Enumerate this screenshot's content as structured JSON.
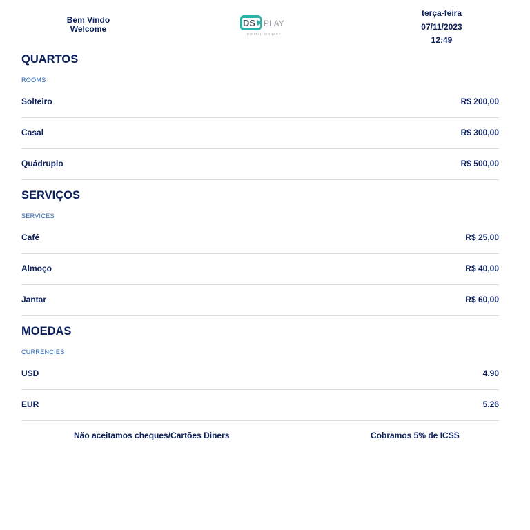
{
  "header": {
    "welcome_pt": "Bem Vindo",
    "welcome_en": "Welcome",
    "logo": {
      "brand_ds": "DS",
      "brand_play": "PLAY",
      "tagline": "DIGITAL SIGNAGE",
      "accent": "#2ab3a8",
      "text_color": "#9aa0a6"
    },
    "weekday": "terça-feira",
    "date": "07/11/2023",
    "time": "12:49"
  },
  "sections": [
    {
      "title": "QUARTOS",
      "subtitle": "ROOMS",
      "items": [
        {
          "name": "Solteiro",
          "price": "R$ 200,00"
        },
        {
          "name": "Casal",
          "price": "R$ 300,00"
        },
        {
          "name": "Quádruplo",
          "price": "R$ 500,00"
        }
      ]
    },
    {
      "title": "SERVIÇOS",
      "subtitle": "SERVICES",
      "items": [
        {
          "name": "Café",
          "price": "R$ 25,00"
        },
        {
          "name": "Almoço",
          "price": "R$ 40,00"
        },
        {
          "name": "Jantar",
          "price": "R$ 60,00"
        }
      ]
    },
    {
      "title": "MOEDAS",
      "subtitle": "CURRENCIES",
      "items": [
        {
          "name": "USD",
          "price": "4.90"
        },
        {
          "name": "EUR",
          "price": "5.26"
        }
      ]
    }
  ],
  "footer": {
    "note_left": "Não aceitamos cheques/Cartões Diners",
    "note_right": "Cobramos 5% de ICSS"
  },
  "colors": {
    "text": "#0b1f5c",
    "subtitle": "#2563b8",
    "divider": "#dcdcdc"
  }
}
